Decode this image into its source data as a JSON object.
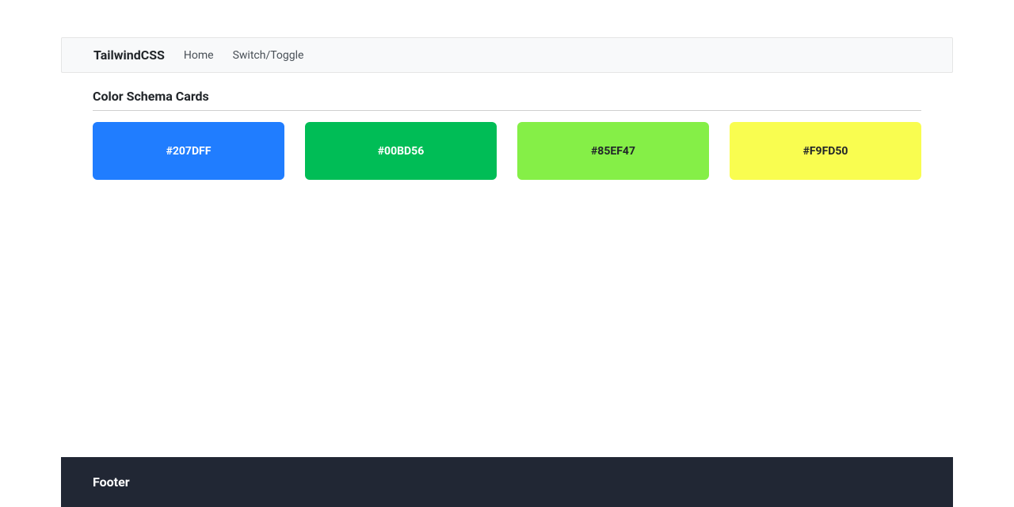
{
  "navbar": {
    "brand": "TailwindCSS",
    "links": [
      {
        "label": "Home"
      },
      {
        "label": "Switch/Toggle"
      }
    ]
  },
  "section": {
    "title": "Color Schema Cards"
  },
  "cards": [
    {
      "hex": "#207DFF",
      "bg": "#207DFF",
      "textClass": "light-text"
    },
    {
      "hex": "#00BD56",
      "bg": "#00BD56",
      "textClass": "light-text"
    },
    {
      "hex": "#85EF47",
      "bg": "#85EF47",
      "textClass": "dark-text"
    },
    {
      "hex": "#F9FD50",
      "bg": "#F9FD50",
      "textClass": "dark-text"
    }
  ],
  "footer": {
    "label": "Footer"
  }
}
